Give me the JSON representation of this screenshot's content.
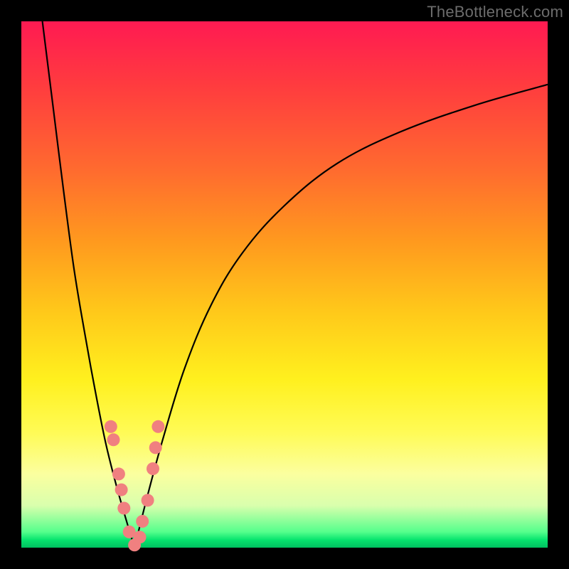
{
  "watermark": "TheBottleneck.com",
  "colors": {
    "frame": "#000000",
    "curve": "#000000",
    "marker_fill": "#f08080",
    "marker_stroke": "#f08080"
  },
  "chart_data": {
    "type": "line",
    "title": "",
    "xlabel": "",
    "ylabel": "",
    "xlim": [
      0,
      100
    ],
    "ylim": [
      0,
      100
    ],
    "grid": false,
    "series": [
      {
        "name": "curve-left",
        "x": [
          4,
          6,
          8,
          10,
          12,
          14,
          16,
          18,
          20,
          21.5
        ],
        "values": [
          100,
          84,
          68,
          53,
          41,
          30,
          20,
          12,
          5,
          0
        ]
      },
      {
        "name": "curve-right",
        "x": [
          21.5,
          24,
          27,
          31,
          36,
          42,
          50,
          60,
          72,
          86,
          100
        ],
        "values": [
          0,
          10,
          21,
          34,
          46,
          56,
          65,
          73,
          79,
          84,
          88
        ]
      }
    ],
    "markers": [
      {
        "x": 17.0,
        "y": 23.0
      },
      {
        "x": 17.5,
        "y": 20.5
      },
      {
        "x": 18.5,
        "y": 14.0
      },
      {
        "x": 19.0,
        "y": 11.0
      },
      {
        "x": 19.5,
        "y": 7.5
      },
      {
        "x": 20.5,
        "y": 3.0
      },
      {
        "x": 21.5,
        "y": 0.5
      },
      {
        "x": 22.5,
        "y": 2.0
      },
      {
        "x": 23.0,
        "y": 5.0
      },
      {
        "x": 24.0,
        "y": 9.0
      },
      {
        "x": 25.0,
        "y": 15.0
      },
      {
        "x": 25.5,
        "y": 19.0
      },
      {
        "x": 26.0,
        "y": 23.0
      }
    ],
    "minimum_x": 21.5
  }
}
